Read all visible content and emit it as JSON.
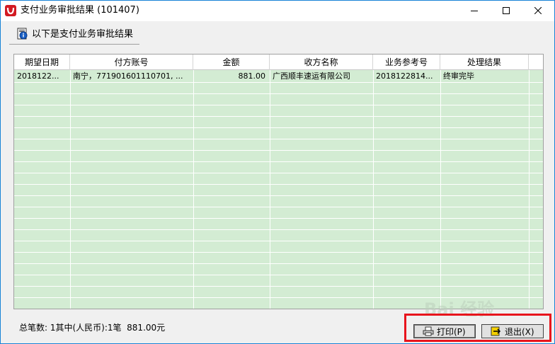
{
  "window": {
    "title": "支付业务审批结果 (101407)",
    "controls": {
      "minimize": "minimize-icon",
      "maximize": "maximize-icon",
      "close": "close-icon"
    }
  },
  "header": {
    "label": "以下是支付业务审批结果",
    "icon": "document-info-icon"
  },
  "table": {
    "columns": [
      "期望日期",
      "付方账号",
      "金额",
      "收方名称",
      "业务参考号",
      "处理结果"
    ],
    "rows": [
      [
        "2018122...",
        "南宁，771901601110701, ...",
        "881.00",
        "广西顺丰速运有限公司",
        "2018122814...",
        "终审完毕"
      ]
    ],
    "row_background": "#d3ecd3"
  },
  "summary": "总笔数: 1其中(人民币):1笔  881.00元",
  "buttons": {
    "print": {
      "label": "打印(P)",
      "icon": "printer-icon"
    },
    "exit": {
      "label": "退出(X)",
      "icon": "exit-icon"
    }
  },
  "watermark": {
    "text": "Bai 经验"
  },
  "colors": {
    "highlight": "#e8141c",
    "grid_fill": "#d3ecd3",
    "title_border": "#1883d7"
  }
}
